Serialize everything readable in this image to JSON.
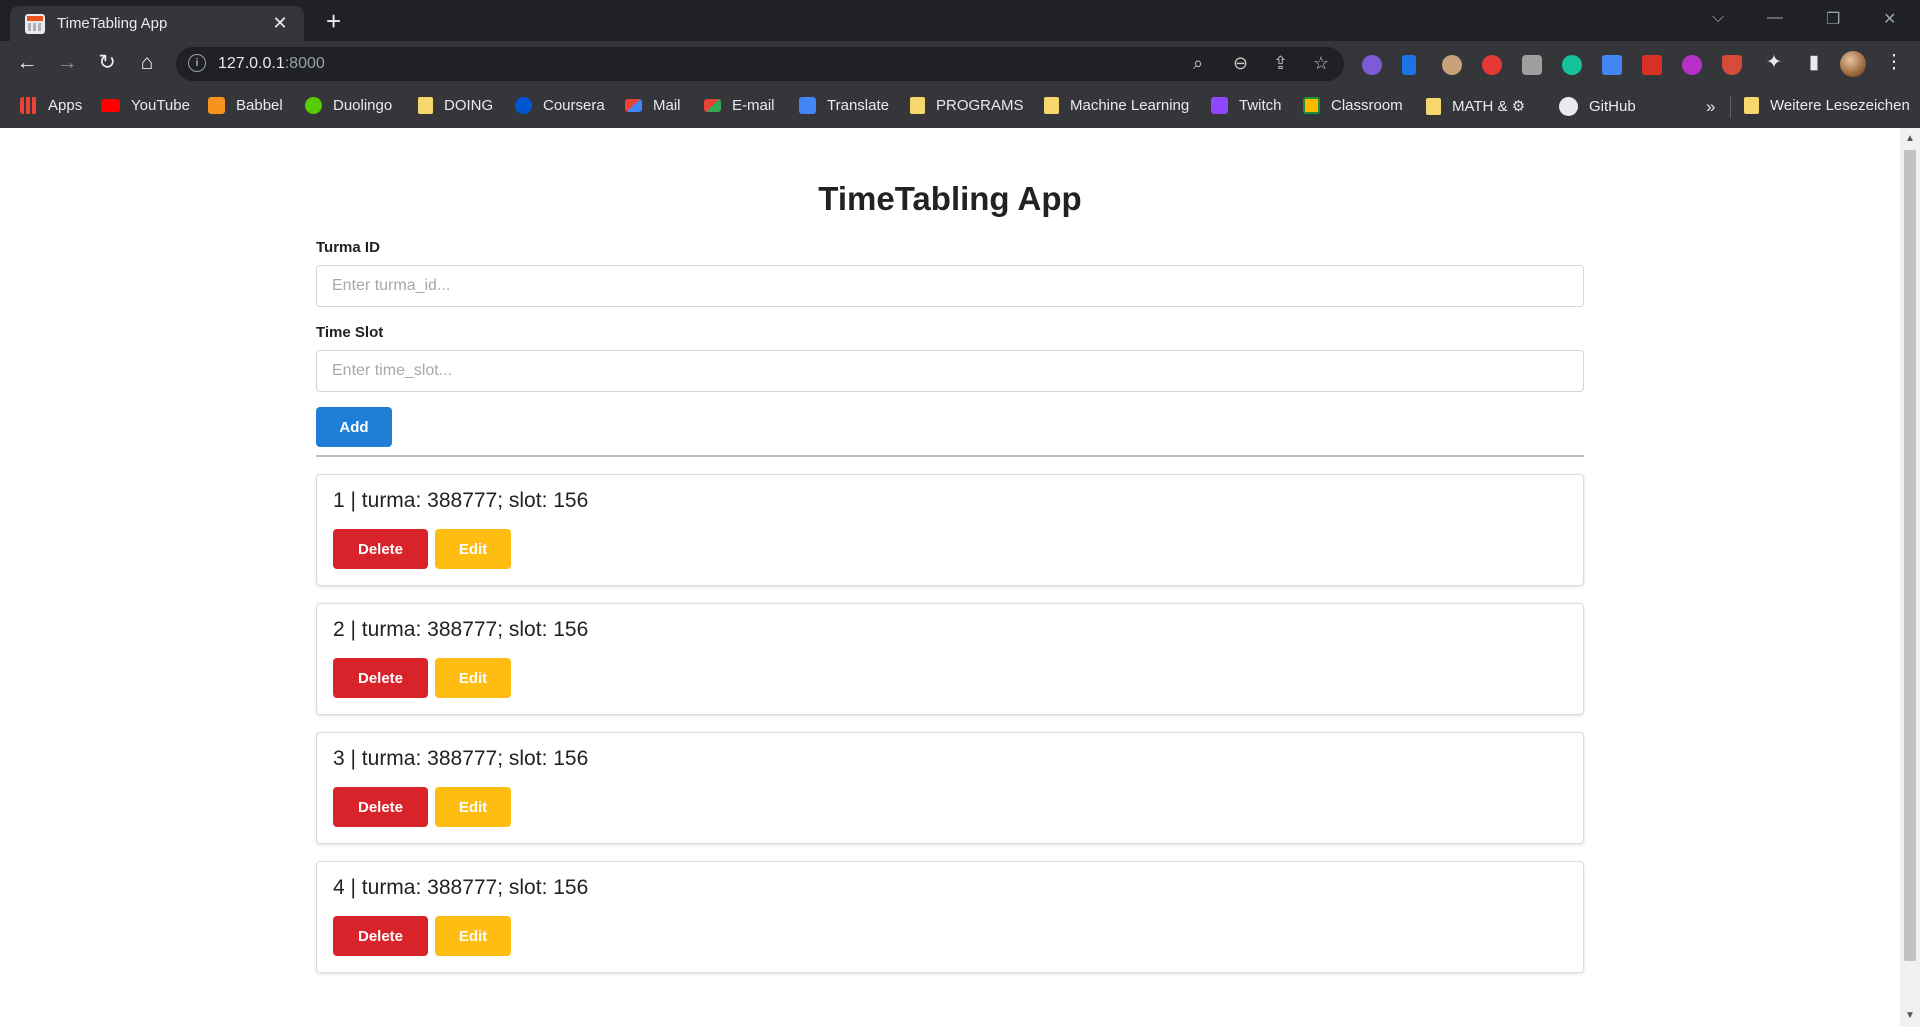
{
  "browser": {
    "tab_title": "TimeTabling App",
    "url_host": "127.0.0.1",
    "url_port": ":8000",
    "bookmarks": [
      {
        "label": "Apps",
        "icon": "apps-grid-icon"
      },
      {
        "label": "YouTube",
        "icon": "youtube-icon"
      },
      {
        "label": "Babbel",
        "icon": "babbel-icon"
      },
      {
        "label": "Duolingo",
        "icon": "duolingo-icon"
      },
      {
        "label": "DOING",
        "icon": "folder-icon"
      },
      {
        "label": "Coursera",
        "icon": "coursera-icon"
      },
      {
        "label": "Mail",
        "icon": "gmail-icon"
      },
      {
        "label": "E-mail",
        "icon": "gmail-icon"
      },
      {
        "label": "Translate",
        "icon": "translate-icon"
      },
      {
        "label": "PROGRAMS",
        "icon": "folder-icon"
      },
      {
        "label": "Machine Learning",
        "icon": "folder-icon"
      },
      {
        "label": "Twitch",
        "icon": "twitch-icon"
      },
      {
        "label": "Classroom",
        "icon": "classroom-icon"
      },
      {
        "label": "MATH & ⚙",
        "icon": "folder-icon"
      },
      {
        "label": "GitHub",
        "icon": "github-icon"
      }
    ],
    "bookmarks_overflow": "»",
    "other_bookmarks": "Weitere Lesezeichen"
  },
  "app": {
    "title": "TimeTabling App",
    "form": {
      "turma_label": "Turma ID",
      "turma_placeholder": "Enter turma_id...",
      "slot_label": "Time Slot",
      "slot_placeholder": "Enter time_slot...",
      "add_label": "Add"
    },
    "items": [
      {
        "text": "1 | turma: 388777; slot: 156",
        "delete_label": "Delete",
        "edit_label": "Edit"
      },
      {
        "text": "2 | turma: 388777; slot: 156",
        "delete_label": "Delete",
        "edit_label": "Edit"
      },
      {
        "text": "3 | turma: 388777; slot: 156",
        "delete_label": "Delete",
        "edit_label": "Edit"
      },
      {
        "text": "4 | turma: 388777; slot: 156",
        "delete_label": "Delete",
        "edit_label": "Edit"
      }
    ]
  },
  "colors": {
    "add": "#1f7fd6",
    "delete": "#d9232a",
    "edit": "#ffbd12"
  }
}
